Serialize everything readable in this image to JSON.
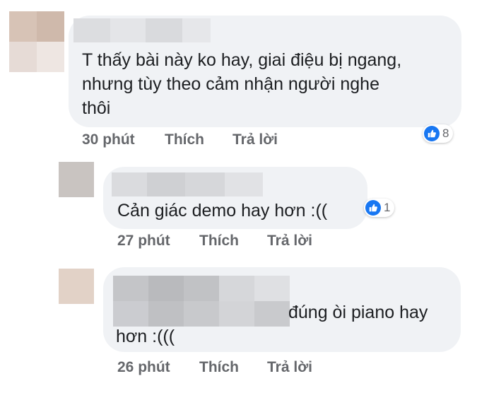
{
  "comments": [
    {
      "text": "T thấy bài này ko hay, giai điệu bị ngang,\nnhưng tùy theo cảm nhận người nghe\nthôi",
      "time": "30 phút",
      "like_label": "Thích",
      "reply_label": "Trả lời",
      "reaction_count": "8"
    },
    {
      "text": "Cản giác demo hay hơn :((",
      "time": "27 phút",
      "like_label": "Thích",
      "reply_label": "Trả lời",
      "reaction_count": "1"
    },
    {
      "text_inline": "đúng òi piano hay",
      "text_line2": "hơn :(((",
      "time": "26 phút",
      "like_label": "Thích",
      "reply_label": "Trả lời"
    }
  ],
  "colors": {
    "bubble": "#f0f2f5",
    "meta_text": "#65676b",
    "like_blue": "#1877f2"
  },
  "icons": {
    "reaction": "like-thumbs-up-icon"
  }
}
